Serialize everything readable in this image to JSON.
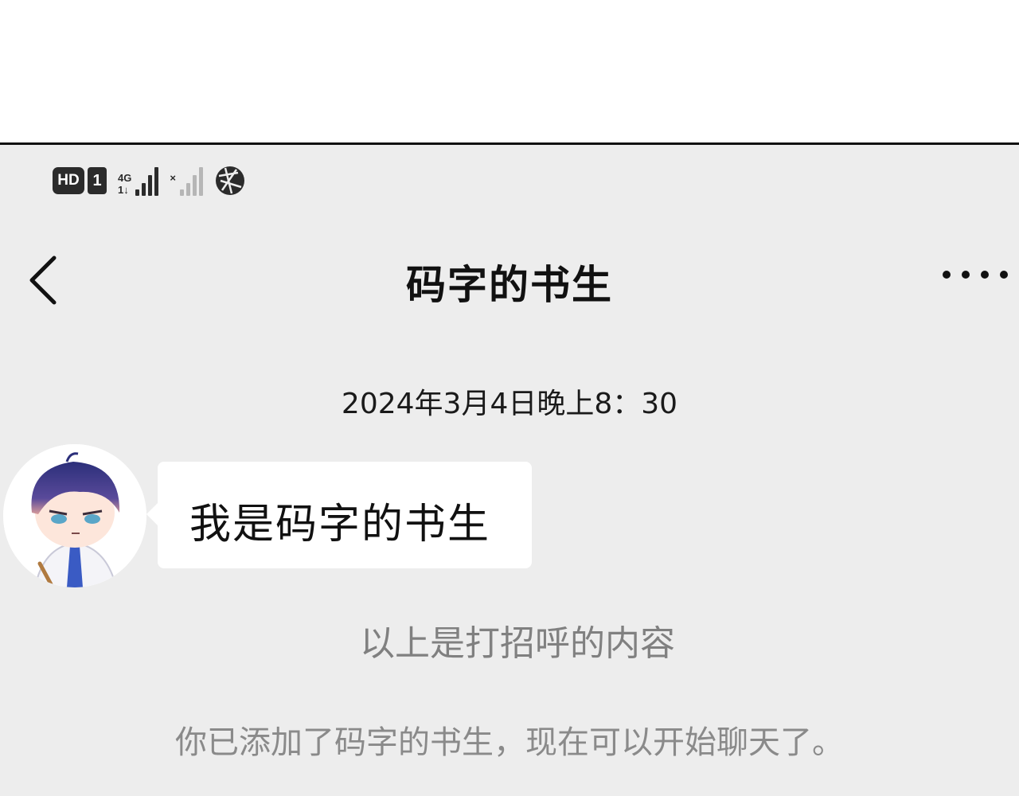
{
  "status_bar": {
    "hd_label": "HD",
    "sim_label": "1",
    "network_label_top": "4G",
    "network_label_bottom": "1↓",
    "sim2_label": "×",
    "icons": [
      "hd-icon",
      "sim-1-icon",
      "signal-4g-icon",
      "signal-off-icon",
      "globe-icon"
    ]
  },
  "nav": {
    "back_icon": "chevron-left-icon",
    "title": "码字的书生",
    "more_icon": "more-dots-icon"
  },
  "chat": {
    "timestamp": "2024年3月4日晚上8：30",
    "messages": [
      {
        "sender": "码字的书生",
        "text": "我是码字的书生"
      }
    ],
    "system_messages": [
      "以上是打招呼的内容",
      "你已添加了码字的书生，现在可以开始聊天了。"
    ]
  },
  "colors": {
    "screen_background": "#ededed",
    "bubble_background": "#ffffff",
    "system_text": "#8a8a8a",
    "title_text": "#111111"
  }
}
